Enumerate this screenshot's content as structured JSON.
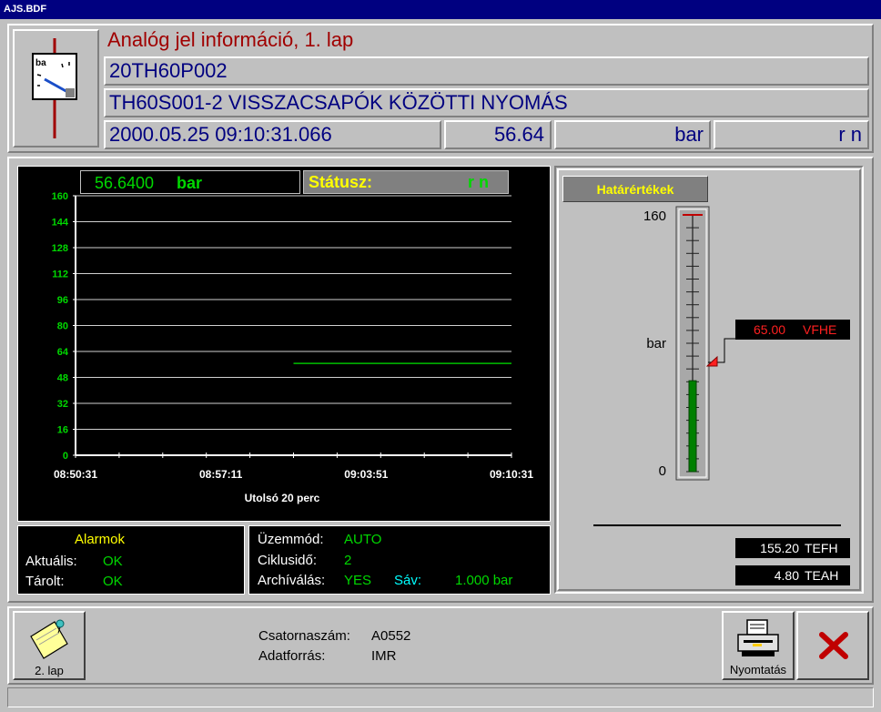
{
  "window": {
    "title": "AJS.BDF"
  },
  "header": {
    "page_title": "Analóg jel információ, 1. lap",
    "code": "20TH60P002",
    "description": "TH60S001-2 VISSZACSAPÓK KÖZÖTTI NYOMÁS",
    "timestamp": "2000.05.25 09:10:31.066",
    "value": "56.64",
    "unit": "bar",
    "status": "r n"
  },
  "trend": {
    "value_display": "56.6400",
    "unit": "bar",
    "status_label": "Státusz:",
    "status_value": "r n",
    "caption": "Utolsó 20 perc"
  },
  "chart_data": {
    "type": "line",
    "x_ticks": [
      "08:50:31",
      "08:57:11",
      "09:03:51",
      "09:10:31"
    ],
    "y_ticks": [
      0,
      16,
      32,
      48,
      64,
      80,
      96,
      112,
      128,
      144,
      160
    ],
    "ylim": [
      0,
      160
    ],
    "xlabel": "Utolsó 20 perc",
    "series": [
      {
        "x": [
          "09:00:31",
          "09:10:31"
        ],
        "values": [
          56.64,
          56.64
        ],
        "color": "#00c000"
      }
    ],
    "grid": true
  },
  "limits": {
    "title": "Határértékek",
    "max_label": "160",
    "min_label": "0",
    "unit": "bar",
    "scale_max": 160,
    "current_value": 56.64,
    "marker_value": 65.0,
    "marker_text": "65.00",
    "marker_code": "VFHE",
    "upper_value": "155.20",
    "upper_code": "TEFH",
    "lower_value": "4.80",
    "lower_code": "TEAH"
  },
  "alarms": {
    "title": "Alarmok",
    "current_label": "Aktuális:",
    "current_value": "OK",
    "stored_label": "Tárolt:",
    "stored_value": "OK"
  },
  "mode": {
    "mode_label": "Üzemmód:",
    "mode_value": "AUTO",
    "cycle_label": "Ciklusidő:",
    "cycle_value": "2",
    "archive_label": "Archíválás:",
    "archive_value": "YES",
    "band_label": "Sáv:",
    "band_value": "1.000 bar"
  },
  "footer": {
    "page2_label": "2. lap",
    "channel_label": "Csatornaszám:",
    "channel_value": "A0552",
    "source_label": "Adatforrás:",
    "source_value": "IMR",
    "print_label": "Nyomtatás"
  }
}
